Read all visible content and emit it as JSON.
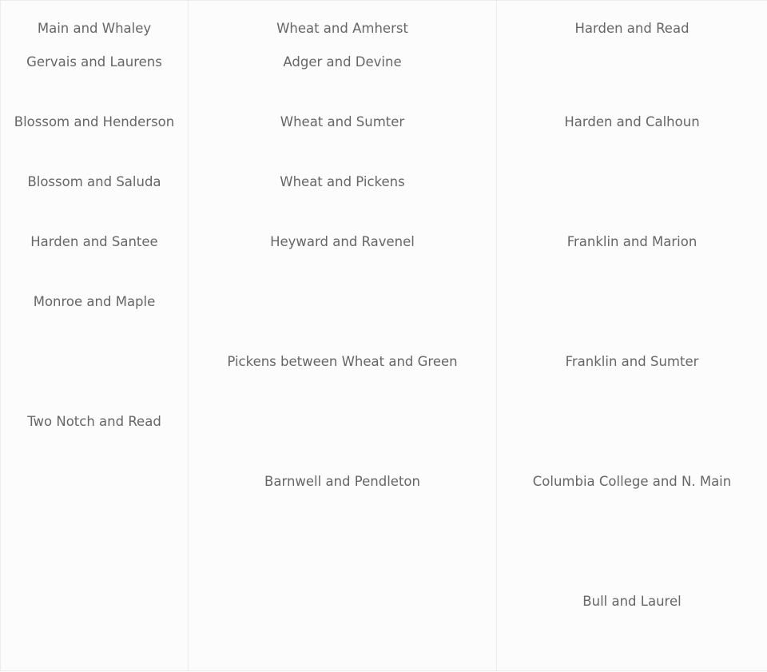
{
  "table": {
    "columns": [
      {
        "paragraphs": [
          [
            "Main and Whaley",
            "Gervais and Laurens"
          ],
          [
            "Blossom and Henderson"
          ],
          [
            "Blossom and Saluda"
          ],
          [
            "Harden and Santee"
          ],
          [
            "Monroe and Maple"
          ],
          [],
          [
            "Two Notch and Read"
          ]
        ]
      },
      {
        "paragraphs": [
          [
            "Wheat and Amherst",
            "Adger and Devine"
          ],
          [
            "Wheat and Sumter"
          ],
          [
            "Wheat and Pickens"
          ],
          [
            "Heyward and Ravenel"
          ],
          [],
          [
            "Pickens between Wheat and Green"
          ],
          [],
          [
            "Barnwell and Pendleton"
          ]
        ]
      },
      {
        "paragraphs": [
          [
            "Harden and Read",
            ""
          ],
          [
            "Harden and Calhoun"
          ],
          [],
          [
            "Franklin and Marion"
          ],
          [],
          [
            "Franklin and Sumter"
          ],
          [],
          [
            "Columbia College and N. Main"
          ],
          [],
          [
            "Bull and Laurel"
          ]
        ]
      }
    ]
  },
  "colors": {
    "background": "#fcfcfc",
    "border": "#ececec",
    "text": "#666666"
  }
}
